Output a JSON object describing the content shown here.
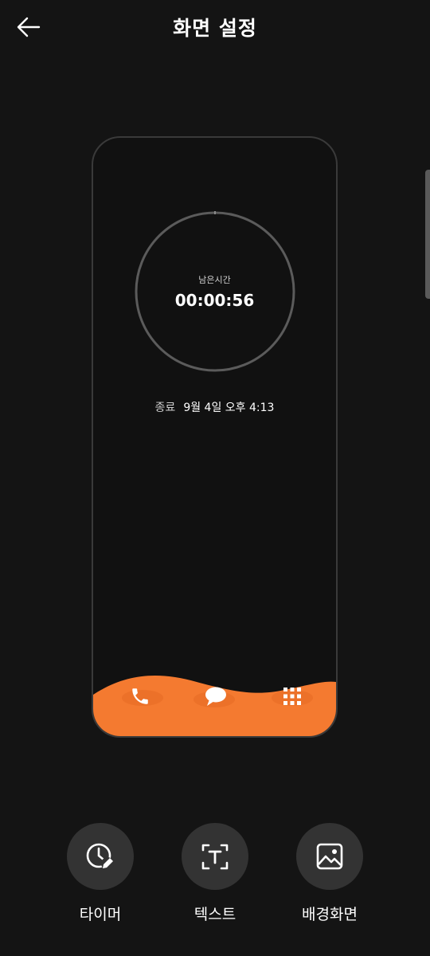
{
  "header": {
    "title": "화면 설정",
    "back_icon": "arrow-left-icon"
  },
  "preview": {
    "timer_label": "남은시간",
    "timer_value": "00:00:56",
    "end_label": "종료",
    "end_value": "9월 4일 오후 4:13",
    "dock_color": "#f47a30",
    "dock_icons": [
      "phone-icon",
      "message-icon",
      "apps-grid-icon"
    ]
  },
  "tools": [
    {
      "label": "타이머",
      "icon": "timer-edit-icon"
    },
    {
      "label": "텍스트",
      "icon": "text-box-icon"
    },
    {
      "label": "배경화면",
      "icon": "image-icon"
    }
  ]
}
